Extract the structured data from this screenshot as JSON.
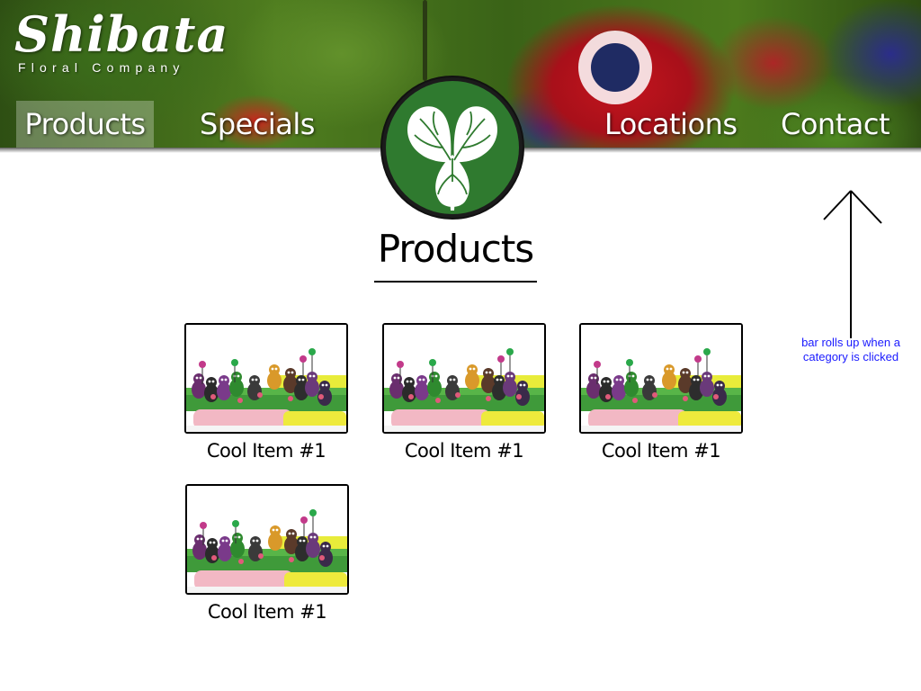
{
  "brand": {
    "name": "Shibata",
    "tagline": "Floral Company"
  },
  "nav": {
    "items": [
      {
        "label": "Products",
        "active": true
      },
      {
        "label": "Specials"
      },
      {
        "label": "Locations"
      },
      {
        "label": "Contact"
      }
    ]
  },
  "page": {
    "title": "Products"
  },
  "products": [
    {
      "name": "Cool Item #1"
    },
    {
      "name": "Cool Item #1"
    },
    {
      "name": "Cool Item #1"
    },
    {
      "name": "Cool Item #1"
    }
  ],
  "annotation": {
    "text": "bar rolls up when a category is clicked",
    "color": "#1a1aff"
  },
  "colors": {
    "emblem_green": "#2f7a2f",
    "nav_text": "#ffffff",
    "active_highlight": "rgba(255,255,255,0.28)"
  }
}
